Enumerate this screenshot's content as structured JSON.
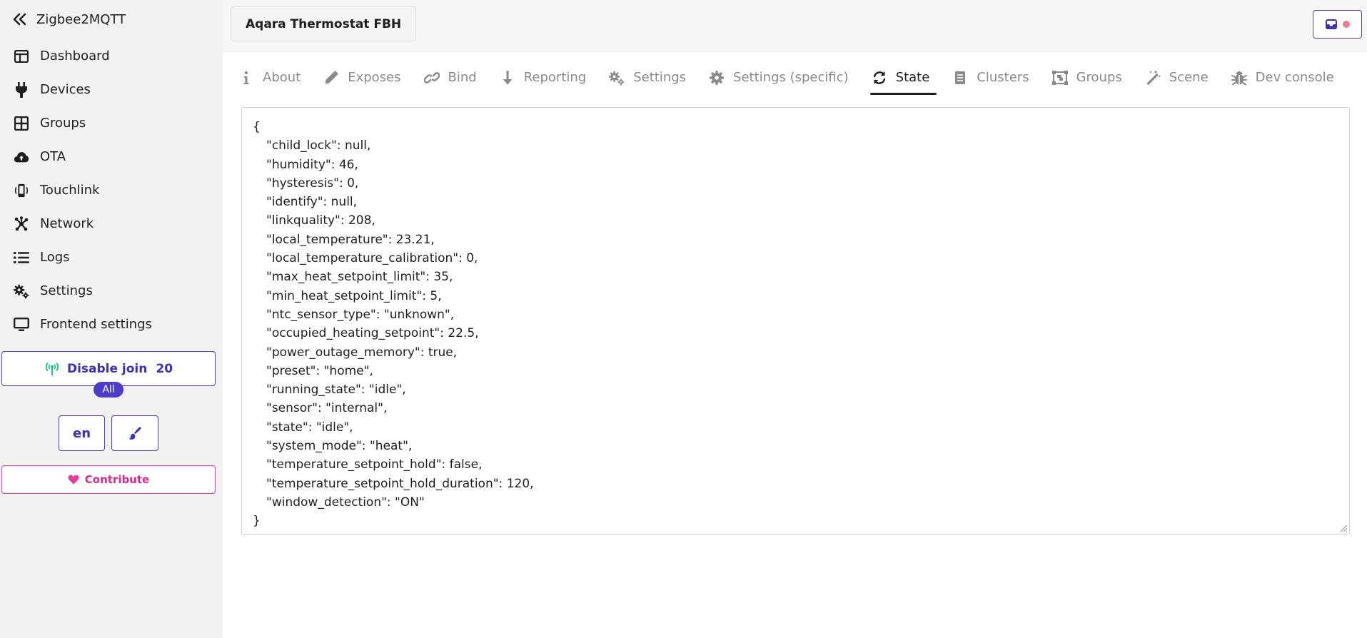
{
  "app": {
    "title": "Zigbee2MQTT"
  },
  "sidebar": {
    "items": [
      {
        "label": "Dashboard",
        "icon": "dashboard-icon"
      },
      {
        "label": "Devices",
        "icon": "plug-icon"
      },
      {
        "label": "Groups",
        "icon": "groups-grid-icon"
      },
      {
        "label": "OTA",
        "icon": "cloud-upload-icon"
      },
      {
        "label": "Touchlink",
        "icon": "touchlink-icon"
      },
      {
        "label": "Network",
        "icon": "network-icon"
      },
      {
        "label": "Logs",
        "icon": "list-icon"
      },
      {
        "label": "Settings",
        "icon": "cogs-icon"
      },
      {
        "label": "Frontend settings",
        "icon": "monitor-icon"
      }
    ],
    "join": {
      "label": "Disable join",
      "countdown": "20",
      "target": "All"
    },
    "language": "en",
    "contribute": "Contribute"
  },
  "device": {
    "name": "Aqara Thermostat FBH"
  },
  "tabs": [
    {
      "label": "About",
      "icon": "info-icon"
    },
    {
      "label": "Exposes",
      "icon": "pencil-icon"
    },
    {
      "label": "Bind",
      "icon": "link-icon"
    },
    {
      "label": "Reporting",
      "icon": "arrow-down-icon"
    },
    {
      "label": "Settings",
      "icon": "cogs-icon"
    },
    {
      "label": "Settings (specific)",
      "icon": "cog-icon"
    },
    {
      "label": "State",
      "icon": "sync-icon",
      "active": true
    },
    {
      "label": "Clusters",
      "icon": "document-icon"
    },
    {
      "label": "Groups",
      "icon": "object-group-icon"
    },
    {
      "label": "Scene",
      "icon": "magic-wand-icon"
    },
    {
      "label": "Dev console",
      "icon": "bug-icon"
    }
  ],
  "state": {
    "open": "{",
    "close": "}",
    "lines": [
      "\"child_lock\": null,",
      "\"humidity\": 46,",
      "\"hysteresis\": 0,",
      "\"identify\": null,",
      "\"linkquality\": 208,",
      "\"local_temperature\": 23.21,",
      "\"local_temperature_calibration\": 0,",
      "\"max_heat_setpoint_limit\": 35,",
      "\"min_heat_setpoint_limit\": 5,",
      "\"ntc_sensor_type\": \"unknown\",",
      "\"occupied_heating_setpoint\": 22.5,",
      "\"power_outage_memory\": true,",
      "\"preset\": \"home\",",
      "\"running_state\": \"idle\",",
      "\"sensor\": \"internal\",",
      "\"state\": \"idle\",",
      "\"system_mode\": \"heat\",",
      "\"temperature_setpoint_hold\": false,",
      "\"temperature_setpoint_hold_duration\": 120,",
      "\"window_detection\": \"ON\""
    ]
  },
  "colors": {
    "accent": "#4b3ccc",
    "contribute": "#e53b9a",
    "join_icon": "#1fbf8f",
    "notification_dot": "#f47a8f"
  }
}
